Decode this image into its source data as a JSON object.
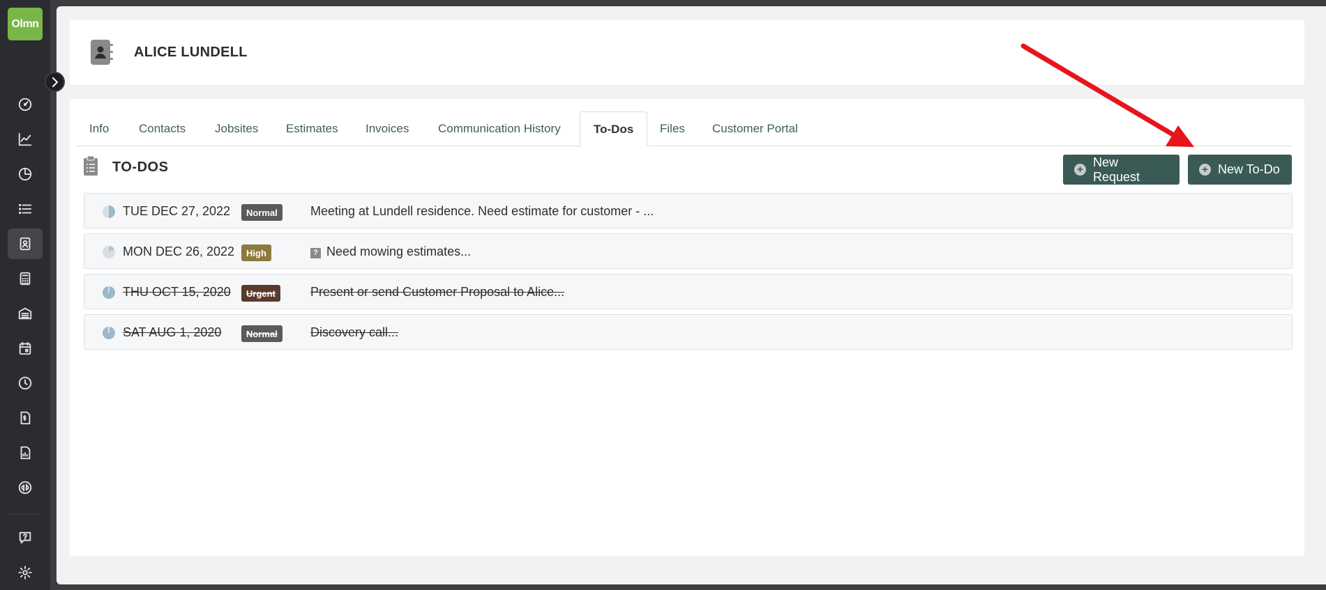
{
  "app": {
    "logo_text": "Olmn"
  },
  "sidebar": {
    "items": [
      {
        "icon": "dashboard-icon"
      },
      {
        "icon": "line-chart-icon"
      },
      {
        "icon": "pie-chart-icon"
      },
      {
        "icon": "list-icon"
      },
      {
        "icon": "contact-book-icon",
        "active": true
      },
      {
        "icon": "calculator-icon"
      },
      {
        "icon": "warehouse-icon"
      },
      {
        "icon": "calendar-icon"
      },
      {
        "icon": "clock-icon"
      },
      {
        "icon": "invoice-icon"
      },
      {
        "icon": "report-icon"
      },
      {
        "icon": "quickbooks-icon"
      },
      {
        "icon": "help-icon"
      },
      {
        "icon": "gear-icon"
      }
    ]
  },
  "customer": {
    "name": "ALICE LUNDELL"
  },
  "tabs": [
    {
      "label": "Info"
    },
    {
      "label": "Contacts"
    },
    {
      "label": "Jobsites"
    },
    {
      "label": "Estimates"
    },
    {
      "label": "Invoices"
    },
    {
      "label": "Communication History"
    },
    {
      "label": "To-Dos",
      "active": true
    },
    {
      "label": "Files"
    },
    {
      "label": "Customer Portal"
    }
  ],
  "todos_section": {
    "title": "TO-DOS",
    "new_request_label": "New Request",
    "new_todo_label": "New To-Do"
  },
  "todos": [
    {
      "date": "TUE DEC 27, 2022",
      "priority": "Normal",
      "priority_color": "#5a5a5a",
      "description": "Meeting at Lundell residence. Need estimate for customer - ...",
      "done": false,
      "has_question": false
    },
    {
      "date": "MON DEC 26, 2022",
      "priority": "High",
      "priority_color": "#8c7a3e",
      "description": "Need mowing estimates...",
      "done": false,
      "has_question": true
    },
    {
      "date": "THU OCT 15, 2020",
      "priority": "Urgent",
      "priority_color": "#5b3a2e",
      "description": "Present or send Customer Proposal to Alice...",
      "done": true,
      "has_question": false
    },
    {
      "date": "SAT AUG 1, 2020",
      "priority": "Normal",
      "priority_color": "#5a5a5a",
      "description": "Discovery call...",
      "done": true,
      "has_question": false
    }
  ],
  "colors": {
    "accent": "#3a5a56",
    "logo": "#7ab648",
    "annotation_arrow": "#e8141b"
  }
}
